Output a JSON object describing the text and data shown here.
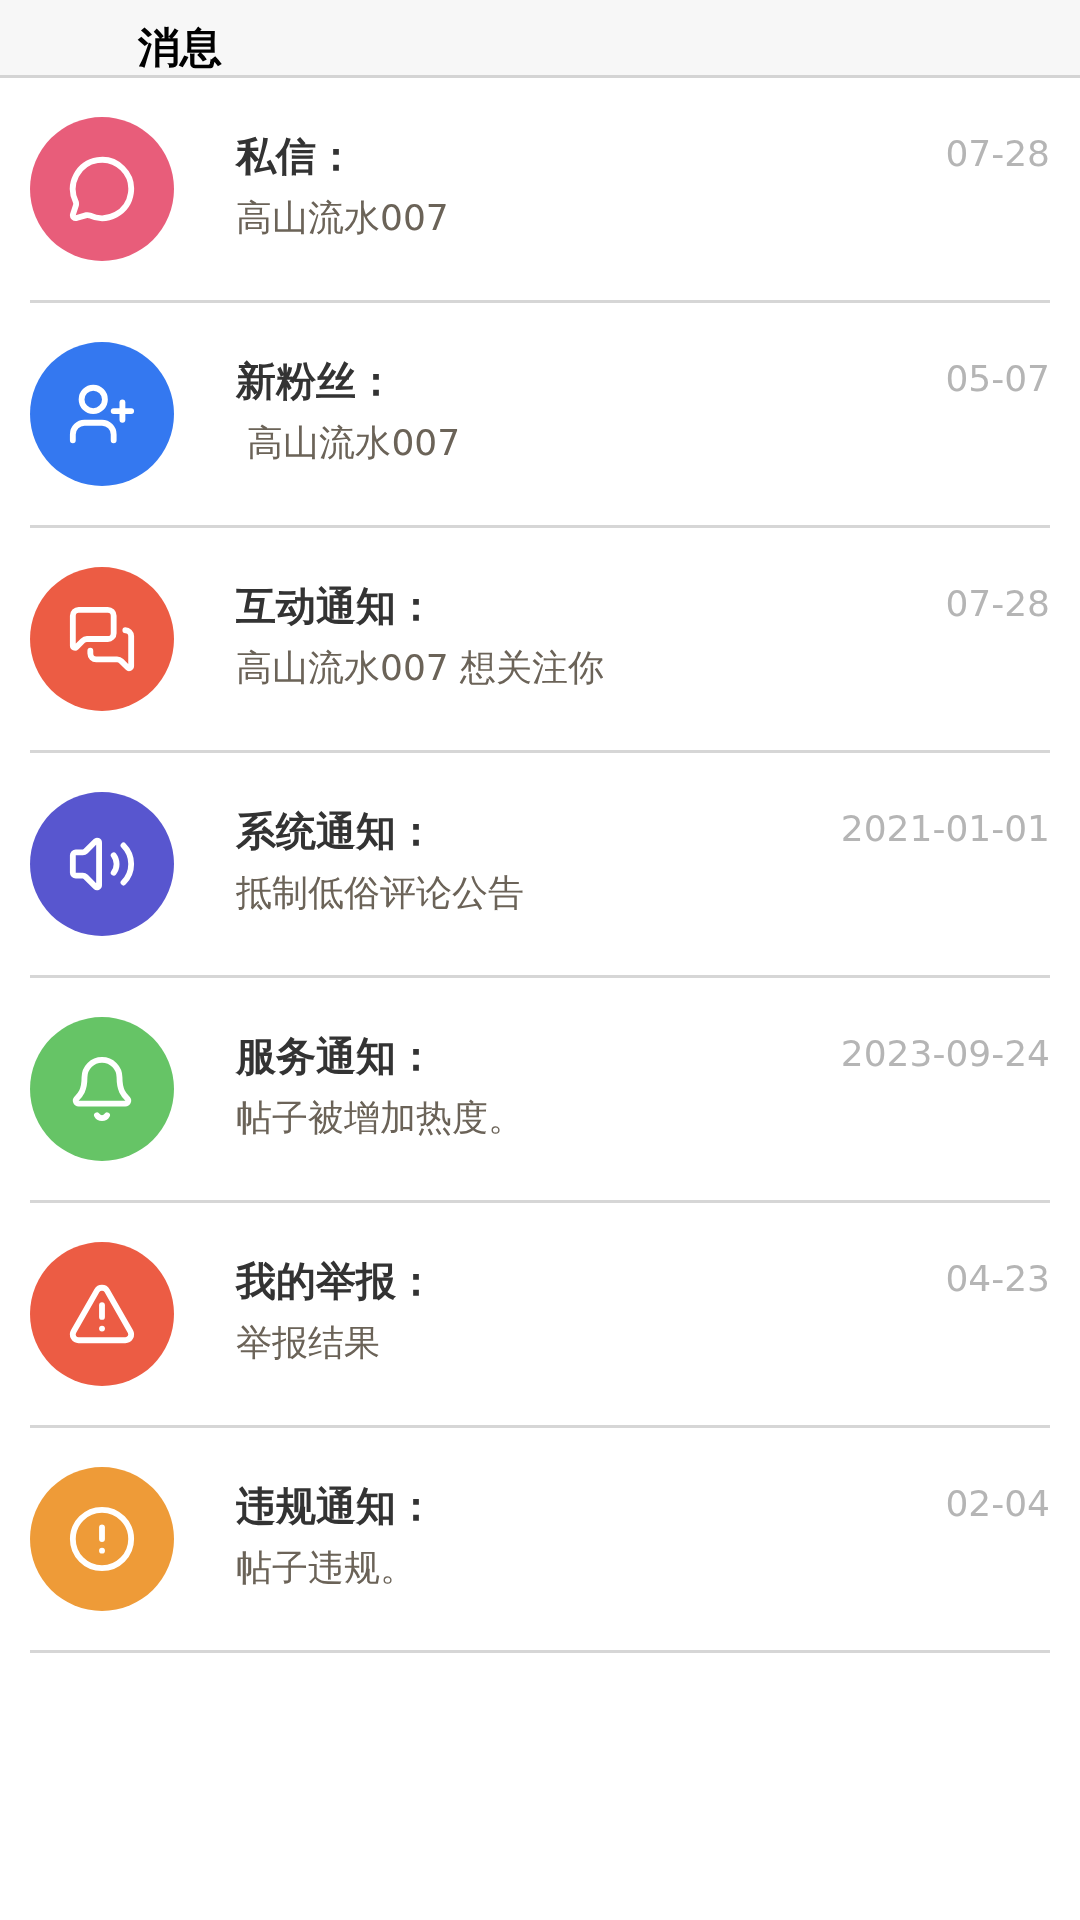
{
  "header": {
    "title": "消息"
  },
  "items": [
    {
      "kind": "chat",
      "color": "#e85d7a",
      "title": "私信：",
      "subtitle": "高山流水007",
      "date": "07-28"
    },
    {
      "kind": "follower",
      "color": "#3478f0",
      "title": "新粉丝：",
      "subtitle": " 高山流水007",
      "date": "05-07"
    },
    {
      "kind": "interaction",
      "color": "#ec5c44",
      "title": "互动通知：",
      "subtitle": "高山流水007 想关注你",
      "date": "07-28"
    },
    {
      "kind": "system",
      "color": "#5856cf",
      "title": "系统通知：",
      "subtitle": "抵制低俗评论公告",
      "date": "2021-01-01"
    },
    {
      "kind": "service",
      "color": "#66c466",
      "title": "服务通知：",
      "subtitle": "帖子被增加热度。",
      "date": "2023-09-24"
    },
    {
      "kind": "report",
      "color": "#ec5c44",
      "title": "我的举报：",
      "subtitle": "举报结果",
      "date": "04-23"
    },
    {
      "kind": "violation",
      "color": "#ee9b38",
      "title": "违规通知：",
      "subtitle": "帖子违规。",
      "date": "02-04"
    }
  ]
}
